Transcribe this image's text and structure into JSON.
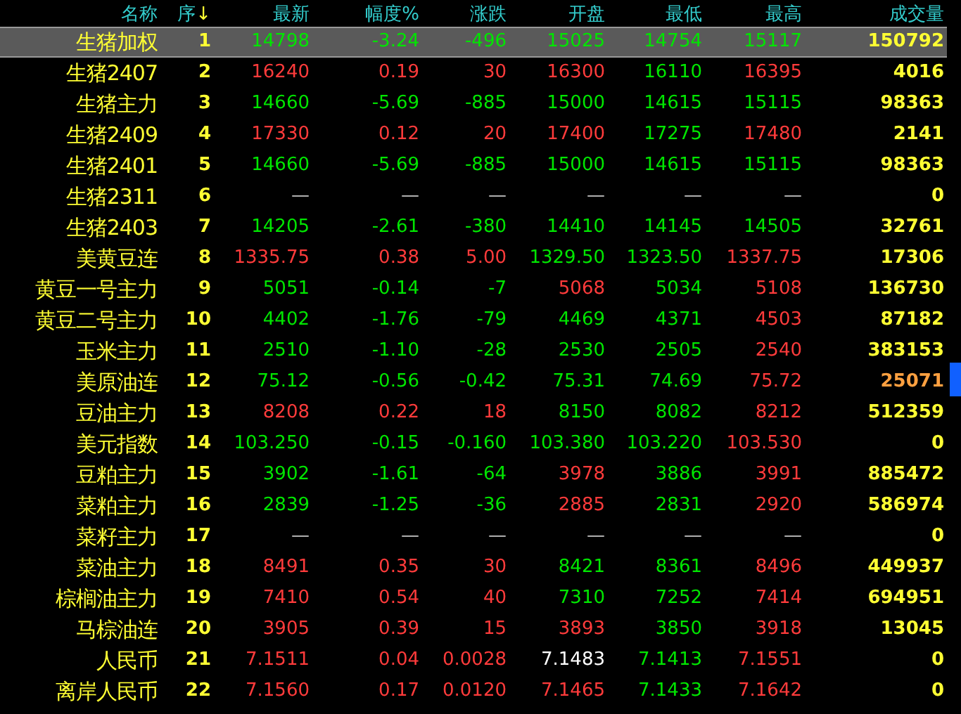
{
  "columns": [
    {
      "label": "名称"
    },
    {
      "label": "序",
      "sort": "↓"
    },
    {
      "label": "最新"
    },
    {
      "label": "幅度%"
    },
    {
      "label": "涨跌"
    },
    {
      "label": "开盘"
    },
    {
      "label": "最低"
    },
    {
      "label": "最高"
    },
    {
      "label": "成交量"
    }
  ],
  "rows": [
    {
      "name": "生猪加权",
      "seq": "1",
      "selected": true,
      "cells": [
        {
          "text": "14798",
          "color": "#00e600"
        },
        {
          "text": "-3.24",
          "color": "#00e600"
        },
        {
          "text": "-496",
          "color": "#00e600"
        },
        {
          "text": "15025",
          "color": "#00e600"
        },
        {
          "text": "14754",
          "color": "#00e600"
        },
        {
          "text": "15117",
          "color": "#00e600"
        }
      ],
      "volume": {
        "text": "150792",
        "color": "#ffff33"
      }
    },
    {
      "name": "生猪2407",
      "seq": "2",
      "selected": false,
      "cells": [
        {
          "text": "16240",
          "color": "#ff3b3b"
        },
        {
          "text": "0.19",
          "color": "#ff3b3b"
        },
        {
          "text": "30",
          "color": "#ff3b3b"
        },
        {
          "text": "16300",
          "color": "#ff3b3b"
        },
        {
          "text": "16110",
          "color": "#00e600"
        },
        {
          "text": "16395",
          "color": "#ff3b3b"
        }
      ],
      "volume": {
        "text": "4016",
        "color": "#ffff33"
      }
    },
    {
      "name": "生猪主力",
      "seq": "3",
      "selected": false,
      "cells": [
        {
          "text": "14660",
          "color": "#00e600"
        },
        {
          "text": "-5.69",
          "color": "#00e600"
        },
        {
          "text": "-885",
          "color": "#00e600"
        },
        {
          "text": "15000",
          "color": "#00e600"
        },
        {
          "text": "14615",
          "color": "#00e600"
        },
        {
          "text": "15115",
          "color": "#00e600"
        }
      ],
      "volume": {
        "text": "98363",
        "color": "#ffff33"
      }
    },
    {
      "name": "生猪2409",
      "seq": "4",
      "selected": false,
      "cells": [
        {
          "text": "17330",
          "color": "#ff3b3b"
        },
        {
          "text": "0.12",
          "color": "#ff3b3b"
        },
        {
          "text": "20",
          "color": "#ff3b3b"
        },
        {
          "text": "17400",
          "color": "#ff3b3b"
        },
        {
          "text": "17275",
          "color": "#00e600"
        },
        {
          "text": "17480",
          "color": "#ff3b3b"
        }
      ],
      "volume": {
        "text": "2141",
        "color": "#ffff33"
      }
    },
    {
      "name": "生猪2401",
      "seq": "5",
      "selected": false,
      "cells": [
        {
          "text": "14660",
          "color": "#00e600"
        },
        {
          "text": "-5.69",
          "color": "#00e600"
        },
        {
          "text": "-885",
          "color": "#00e600"
        },
        {
          "text": "15000",
          "color": "#00e600"
        },
        {
          "text": "14615",
          "color": "#00e600"
        },
        {
          "text": "15115",
          "color": "#00e600"
        }
      ],
      "volume": {
        "text": "98363",
        "color": "#ffff33"
      }
    },
    {
      "name": "生猪2311",
      "seq": "6",
      "selected": false,
      "cells": [
        {
          "text": "—",
          "color": "#c0c0c0"
        },
        {
          "text": "—",
          "color": "#c0c0c0"
        },
        {
          "text": "—",
          "color": "#c0c0c0"
        },
        {
          "text": "—",
          "color": "#c0c0c0"
        },
        {
          "text": "—",
          "color": "#c0c0c0"
        },
        {
          "text": "—",
          "color": "#c0c0c0"
        }
      ],
      "volume": {
        "text": "0",
        "color": "#ffff33"
      }
    },
    {
      "name": "生猪2403",
      "seq": "7",
      "selected": false,
      "cells": [
        {
          "text": "14205",
          "color": "#00e600"
        },
        {
          "text": "-2.61",
          "color": "#00e600"
        },
        {
          "text": "-380",
          "color": "#00e600"
        },
        {
          "text": "14410",
          "color": "#00e600"
        },
        {
          "text": "14145",
          "color": "#00e600"
        },
        {
          "text": "14505",
          "color": "#00e600"
        }
      ],
      "volume": {
        "text": "32761",
        "color": "#ffff33"
      }
    },
    {
      "name": "美黄豆连",
      "seq": "8",
      "selected": false,
      "cells": [
        {
          "text": "1335.75",
          "color": "#ff3b3b"
        },
        {
          "text": "0.38",
          "color": "#ff3b3b"
        },
        {
          "text": "5.00",
          "color": "#ff3b3b"
        },
        {
          "text": "1329.50",
          "color": "#00e600"
        },
        {
          "text": "1323.50",
          "color": "#00e600"
        },
        {
          "text": "1337.75",
          "color": "#ff3b3b"
        }
      ],
      "volume": {
        "text": "17306",
        "color": "#ffff33"
      }
    },
    {
      "name": "黄豆一号主力",
      "seq": "9",
      "selected": false,
      "cells": [
        {
          "text": "5051",
          "color": "#00e600"
        },
        {
          "text": "-0.14",
          "color": "#00e600"
        },
        {
          "text": "-7",
          "color": "#00e600"
        },
        {
          "text": "5068",
          "color": "#ff3b3b"
        },
        {
          "text": "5034",
          "color": "#00e600"
        },
        {
          "text": "5108",
          "color": "#ff3b3b"
        }
      ],
      "volume": {
        "text": "136730",
        "color": "#ffff33"
      }
    },
    {
      "name": "黄豆二号主力",
      "seq": "10",
      "selected": false,
      "cells": [
        {
          "text": "4402",
          "color": "#00e600"
        },
        {
          "text": "-1.76",
          "color": "#00e600"
        },
        {
          "text": "-79",
          "color": "#00e600"
        },
        {
          "text": "4469",
          "color": "#00e600"
        },
        {
          "text": "4371",
          "color": "#00e600"
        },
        {
          "text": "4503",
          "color": "#ff3b3b"
        }
      ],
      "volume": {
        "text": "87182",
        "color": "#ffff33"
      }
    },
    {
      "name": "玉米主力",
      "seq": "11",
      "selected": false,
      "cells": [
        {
          "text": "2510",
          "color": "#00e600"
        },
        {
          "text": "-1.10",
          "color": "#00e600"
        },
        {
          "text": "-28",
          "color": "#00e600"
        },
        {
          "text": "2530",
          "color": "#00e600"
        },
        {
          "text": "2505",
          "color": "#00e600"
        },
        {
          "text": "2540",
          "color": "#ff3b3b"
        }
      ],
      "volume": {
        "text": "383153",
        "color": "#ffff33"
      }
    },
    {
      "name": "美原油连",
      "seq": "12",
      "selected": false,
      "cells": [
        {
          "text": "75.12",
          "color": "#00e600"
        },
        {
          "text": "-0.56",
          "color": "#00e600"
        },
        {
          "text": "-0.42",
          "color": "#00e600"
        },
        {
          "text": "75.31",
          "color": "#00e600"
        },
        {
          "text": "74.69",
          "color": "#00e600"
        },
        {
          "text": "75.72",
          "color": "#ff3b3b"
        }
      ],
      "volume": {
        "text": "25071",
        "color": "#ffa040"
      }
    },
    {
      "name": "豆油主力",
      "seq": "13",
      "selected": false,
      "cells": [
        {
          "text": "8208",
          "color": "#ff3b3b"
        },
        {
          "text": "0.22",
          "color": "#ff3b3b"
        },
        {
          "text": "18",
          "color": "#ff3b3b"
        },
        {
          "text": "8150",
          "color": "#00e600"
        },
        {
          "text": "8082",
          "color": "#00e600"
        },
        {
          "text": "8212",
          "color": "#ff3b3b"
        }
      ],
      "volume": {
        "text": "512359",
        "color": "#ffff33"
      }
    },
    {
      "name": "美元指数",
      "seq": "14",
      "selected": false,
      "cells": [
        {
          "text": "103.250",
          "color": "#00e600"
        },
        {
          "text": "-0.15",
          "color": "#00e600"
        },
        {
          "text": "-0.160",
          "color": "#00e600"
        },
        {
          "text": "103.380",
          "color": "#00e600"
        },
        {
          "text": "103.220",
          "color": "#00e600"
        },
        {
          "text": "103.530",
          "color": "#ff3b3b"
        }
      ],
      "volume": {
        "text": "0",
        "color": "#ffff33"
      }
    },
    {
      "name": "豆粕主力",
      "seq": "15",
      "selected": false,
      "cells": [
        {
          "text": "3902",
          "color": "#00e600"
        },
        {
          "text": "-1.61",
          "color": "#00e600"
        },
        {
          "text": "-64",
          "color": "#00e600"
        },
        {
          "text": "3978",
          "color": "#ff3b3b"
        },
        {
          "text": "3886",
          "color": "#00e600"
        },
        {
          "text": "3991",
          "color": "#ff3b3b"
        }
      ],
      "volume": {
        "text": "885472",
        "color": "#ffff33"
      }
    },
    {
      "name": "菜粕主力",
      "seq": "16",
      "selected": false,
      "cells": [
        {
          "text": "2839",
          "color": "#00e600"
        },
        {
          "text": "-1.25",
          "color": "#00e600"
        },
        {
          "text": "-36",
          "color": "#00e600"
        },
        {
          "text": "2885",
          "color": "#ff3b3b"
        },
        {
          "text": "2831",
          "color": "#00e600"
        },
        {
          "text": "2920",
          "color": "#ff3b3b"
        }
      ],
      "volume": {
        "text": "586974",
        "color": "#ffff33"
      }
    },
    {
      "name": "菜籽主力",
      "seq": "17",
      "selected": false,
      "cells": [
        {
          "text": "—",
          "color": "#c0c0c0"
        },
        {
          "text": "—",
          "color": "#c0c0c0"
        },
        {
          "text": "—",
          "color": "#c0c0c0"
        },
        {
          "text": "—",
          "color": "#c0c0c0"
        },
        {
          "text": "—",
          "color": "#c0c0c0"
        },
        {
          "text": "—",
          "color": "#c0c0c0"
        }
      ],
      "volume": {
        "text": "0",
        "color": "#ffff33"
      }
    },
    {
      "name": "菜油主力",
      "seq": "18",
      "selected": false,
      "cells": [
        {
          "text": "8491",
          "color": "#ff3b3b"
        },
        {
          "text": "0.35",
          "color": "#ff3b3b"
        },
        {
          "text": "30",
          "color": "#ff3b3b"
        },
        {
          "text": "8421",
          "color": "#00e600"
        },
        {
          "text": "8361",
          "color": "#00e600"
        },
        {
          "text": "8496",
          "color": "#ff3b3b"
        }
      ],
      "volume": {
        "text": "449937",
        "color": "#ffff33"
      }
    },
    {
      "name": "棕榈油主力",
      "seq": "19",
      "selected": false,
      "cells": [
        {
          "text": "7410",
          "color": "#ff3b3b"
        },
        {
          "text": "0.54",
          "color": "#ff3b3b"
        },
        {
          "text": "40",
          "color": "#ff3b3b"
        },
        {
          "text": "7310",
          "color": "#00e600"
        },
        {
          "text": "7252",
          "color": "#00e600"
        },
        {
          "text": "7414",
          "color": "#ff3b3b"
        }
      ],
      "volume": {
        "text": "694951",
        "color": "#ffff33"
      }
    },
    {
      "name": "马棕油连",
      "seq": "20",
      "selected": false,
      "cells": [
        {
          "text": "3905",
          "color": "#ff3b3b"
        },
        {
          "text": "0.39",
          "color": "#ff3b3b"
        },
        {
          "text": "15",
          "color": "#ff3b3b"
        },
        {
          "text": "3893",
          "color": "#ff3b3b"
        },
        {
          "text": "3850",
          "color": "#00e600"
        },
        {
          "text": "3918",
          "color": "#ff3b3b"
        }
      ],
      "volume": {
        "text": "13045",
        "color": "#ffff33"
      }
    },
    {
      "name": "人民币",
      "seq": "21",
      "selected": false,
      "cells": [
        {
          "text": "7.1511",
          "color": "#ff3b3b"
        },
        {
          "text": "0.04",
          "color": "#ff3b3b"
        },
        {
          "text": "0.0028",
          "color": "#ff3b3b"
        },
        {
          "text": "7.1483",
          "color": "#ffffff"
        },
        {
          "text": "7.1413",
          "color": "#00e600"
        },
        {
          "text": "7.1551",
          "color": "#ff3b3b"
        }
      ],
      "volume": {
        "text": "0",
        "color": "#ffff33"
      }
    },
    {
      "name": "离岸人民币",
      "seq": "22",
      "selected": false,
      "cells": [
        {
          "text": "7.1560",
          "color": "#ff3b3b"
        },
        {
          "text": "0.17",
          "color": "#ff3b3b"
        },
        {
          "text": "0.0120",
          "color": "#ff3b3b"
        },
        {
          "text": "7.1465",
          "color": "#ff3b3b"
        },
        {
          "text": "7.1433",
          "color": "#00e600"
        },
        {
          "text": "7.1642",
          "color": "#ff3b3b"
        }
      ],
      "volume": {
        "text": "0",
        "color": "#ffff33"
      }
    }
  ]
}
